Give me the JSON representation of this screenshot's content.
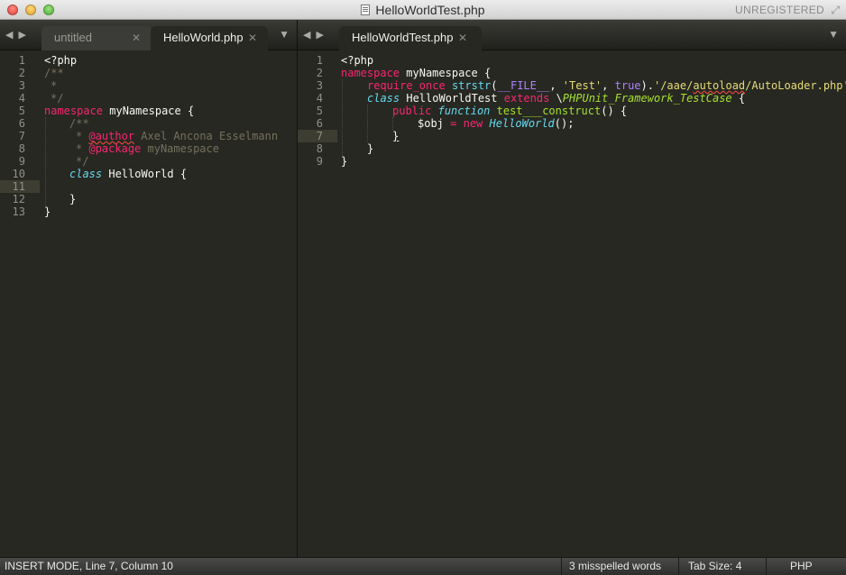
{
  "window": {
    "title": "HelloWorldTest.php",
    "license": "UNREGISTERED"
  },
  "left_pane": {
    "tabs": [
      {
        "label": "untitled",
        "active": false
      },
      {
        "label": "HelloWorld.php",
        "active": true
      }
    ],
    "line_numbers": [
      "1",
      "2",
      "3",
      "4",
      "5",
      "6",
      "7",
      "8",
      "9",
      "10",
      "11",
      "12",
      "13"
    ]
  },
  "right_pane": {
    "tabs": [
      {
        "label": "HelloWorldTest.php",
        "active": true
      }
    ],
    "line_numbers": [
      "1",
      "2",
      "3",
      "4",
      "5",
      "6",
      "7",
      "8",
      "9"
    ]
  },
  "code": {
    "php_open": "<?php",
    "doc_open": "/**",
    "star": "*",
    "doc_close": "*/",
    "namespace_kw": "namespace",
    "namespace_name": "myNamespace",
    "brace_open": "{",
    "brace_close": "}",
    "author_tag": "@author",
    "author_name": "Axel",
    "author_mid": "Ancona",
    "author_last": "Esselmann",
    "package_tag": "@package",
    "package_name": "myNamespace",
    "class_kw": "class",
    "class_name": "HelloWorld",
    "require_kw": "require_once",
    "strstr_fn": "strstr",
    "paren_open": "(",
    "file_const": "__FILE__",
    "comma": ",",
    "test_str": "'Test'",
    "true_const": "true",
    "concat": ").",
    "path_str_a": "'/aae/",
    "path_str_b": "autoload",
    "path_str_c": "/AutoLoader.php'",
    "semicolon": ";",
    "test_class": "HelloWorldTest",
    "extends_kw": "extends",
    "backslash": "\\",
    "parent_class": "PHPUnit_Framework_TestCase",
    "public_kw": "public",
    "function_kw": "function",
    "construct_fn": "test___construct",
    "empty_parens": "()",
    "obj_var": "$obj",
    "assign": "=",
    "new_kw": "new",
    "new_class": "HelloWorld",
    "call_end": "();"
  },
  "statusbar": {
    "mode": "INSERT MODE, Line 7, Column 10",
    "spelling": "3 misspelled words",
    "tab_size": "Tab Size: 4",
    "syntax": "PHP"
  }
}
